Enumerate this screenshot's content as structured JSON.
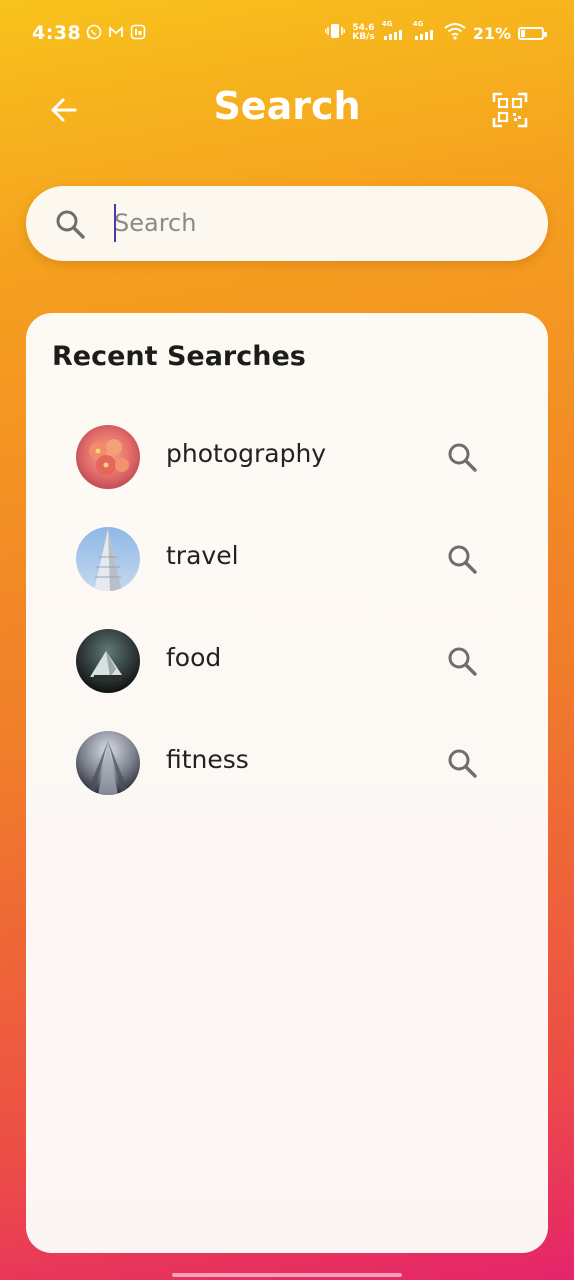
{
  "status_bar": {
    "time": "4:38",
    "net_speed_value": "54.6",
    "net_speed_unit": "KB/s",
    "signal1_label": "4G",
    "signal2_label": "4G",
    "battery_percent": "21%",
    "battery_level": 0.21
  },
  "header": {
    "title": "Search"
  },
  "search": {
    "placeholder": "Search",
    "value": ""
  },
  "recent": {
    "title": "Recent Searches",
    "items": [
      {
        "label": "photography"
      },
      {
        "label": "travel"
      },
      {
        "label": "food"
      },
      {
        "label": "fitness"
      }
    ]
  },
  "colors": {
    "gradient_top": "#f8c21c",
    "gradient_mid": "#f07d2a",
    "gradient_bottom": "#e5246b",
    "panel_bg": "#fdfaf4",
    "icon_gray": "#6e6e6e"
  }
}
